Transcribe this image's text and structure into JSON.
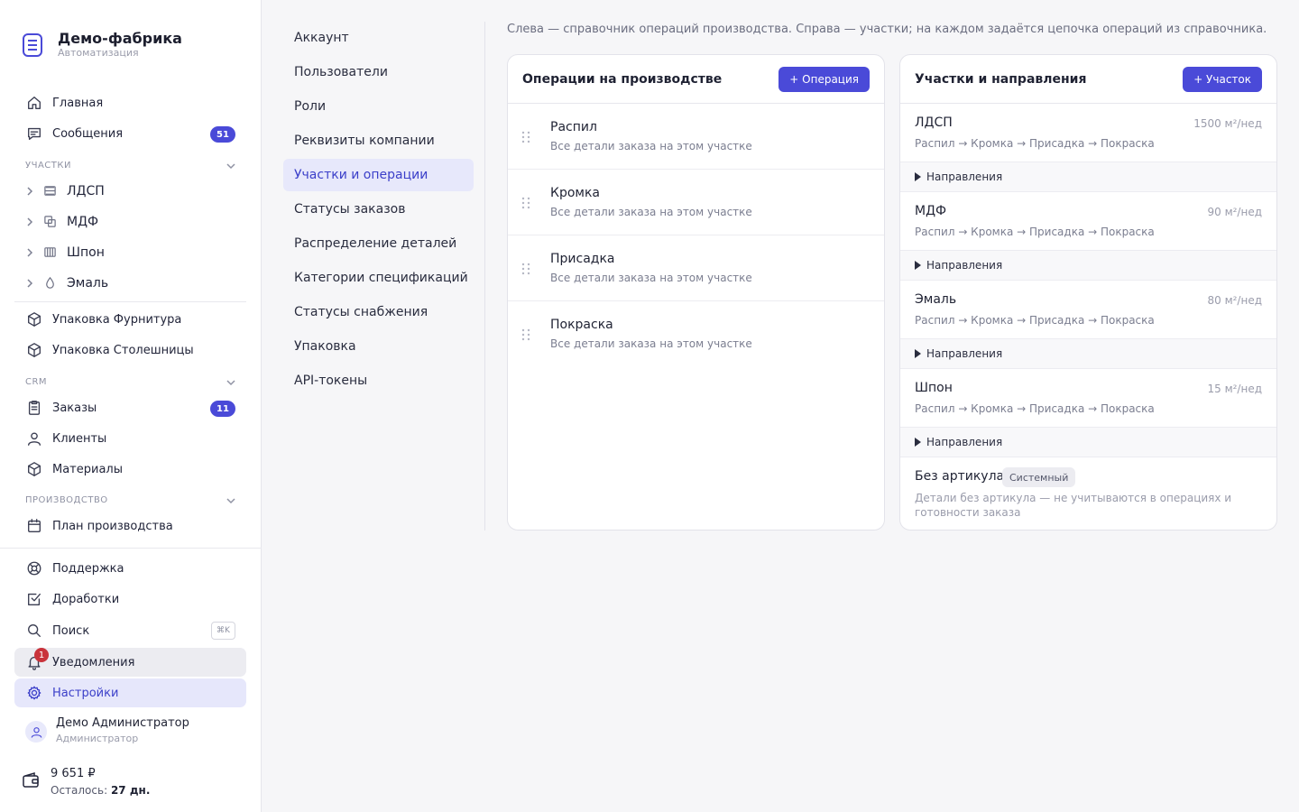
{
  "brand": {
    "name": "Демо-фабрика",
    "subtitle": "Автоматизация"
  },
  "sidebar": {
    "home": "Главная",
    "messages": {
      "label": "Сообщения",
      "badge": "51"
    },
    "sections_label": "УЧАСТКИ",
    "sections": [
      "ЛДСП",
      "МДФ",
      "Шпон",
      "Эмаль"
    ],
    "packaging_fittings": "Упаковка Фурнитура",
    "packaging_tops": "Упаковка Столешницы",
    "crm_label": "CRM",
    "orders": {
      "label": "Заказы",
      "badge": "11"
    },
    "clients": "Клиенты",
    "materials": "Материалы",
    "production_label": "ПРОИЗВОДСТВО",
    "production_plan": "План производства",
    "support": "Поддержка",
    "improvements": "Доработки",
    "search": {
      "label": "Поиск",
      "shortcut": "⌘K"
    },
    "notifications": {
      "label": "Уведомления",
      "count": "1"
    },
    "settings": "Настройки",
    "user": {
      "name": "Демо Администратор",
      "role": "Администратор"
    },
    "balance": {
      "amount": "9 651 ₽",
      "left_label": "Осталось:",
      "left_value": "27 дн."
    }
  },
  "settings_menu": [
    "Аккаунт",
    "Пользователи",
    "Роли",
    "Реквизиты компании",
    "Участки и операции",
    "Статусы заказов",
    "Распределение деталей",
    "Категории спецификаций",
    "Статусы снабжения",
    "Упаковка",
    "API-токены"
  ],
  "settings_menu_active": "Участки и операции",
  "description": "Слева — справочник операций производства. Справа — участки; на каждом задаётся цепочка операций из справочника.",
  "operations": {
    "title": "Операции на производстве",
    "add_button": "+ Операция",
    "items": [
      {
        "name": "Распил",
        "desc": "Все детали заказа на этом участке"
      },
      {
        "name": "Кромка",
        "desc": "Все детали заказа на этом участке"
      },
      {
        "name": "Присадка",
        "desc": "Все детали заказа на этом участке"
      },
      {
        "name": "Покраска",
        "desc": "Все детали заказа на этом участке"
      }
    ]
  },
  "sections_panel": {
    "title": "Участки и направления",
    "add_button": "+ Участок",
    "directions_label": "Направления",
    "items": [
      {
        "name": "ЛДСП",
        "rate": "1500 м²/нед",
        "chain": "Распил → Кромка → Присадка → Покраска"
      },
      {
        "name": "МДФ",
        "rate": "90 м²/нед",
        "chain": "Распил → Кромка → Присадка → Покраска"
      },
      {
        "name": "Эмаль",
        "rate": "80 м²/нед",
        "chain": "Распил → Кромка → Присадка → Покраска"
      },
      {
        "name": "Шпон",
        "rate": "15 м²/нед",
        "chain": "Распил → Кромка → Присадка → Покраска"
      }
    ],
    "system": {
      "name": "Без артикула",
      "badge": "Системный",
      "desc": "Детали без артикула — не учитываются в операциях и готовности заказа"
    }
  },
  "colors": {
    "accent": "#4a4ad8",
    "active_bg": "#e6e7fb",
    "notification": "#c9333b"
  }
}
